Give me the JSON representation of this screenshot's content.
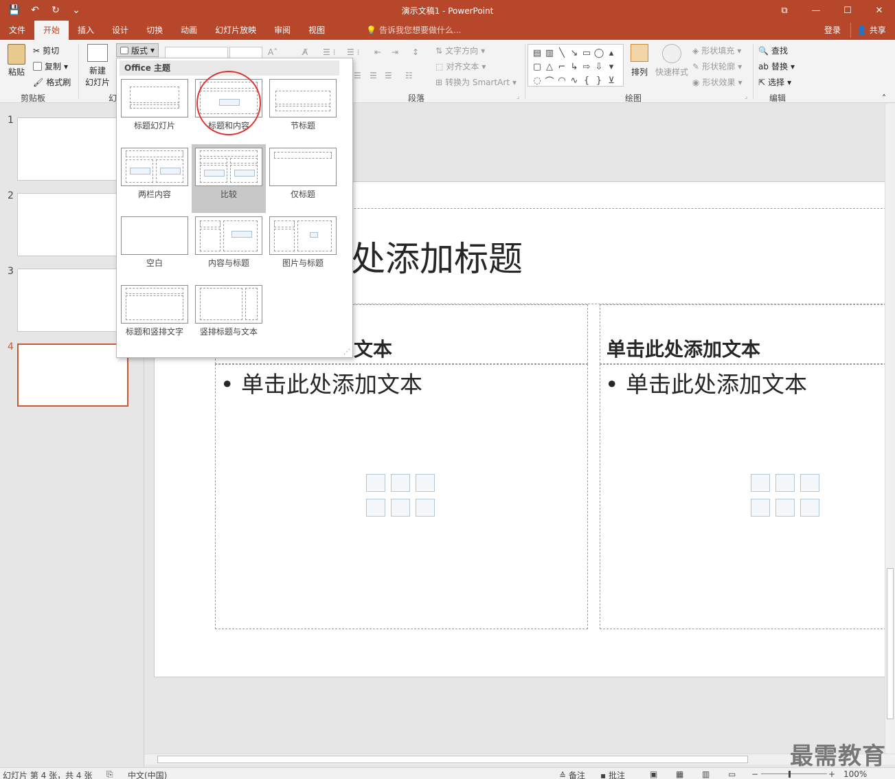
{
  "window": {
    "title": "演示文稿1 - PowerPoint",
    "controls": {
      "restore": "⧉",
      "minimize": "—",
      "maximize": "☐",
      "close": "✕"
    }
  },
  "qat": {
    "save": "💾",
    "undo": "↶",
    "redo": "↻",
    "customize": "⌄"
  },
  "tabs": [
    "文件",
    "开始",
    "插入",
    "设计",
    "切换",
    "动画",
    "幻灯片放映",
    "审阅",
    "视图"
  ],
  "active_tab": "开始",
  "tellme": {
    "placeholder": "告诉我您想要做什么..."
  },
  "account": {
    "signin": "登录",
    "share": "共享"
  },
  "ribbon": {
    "clipboard": {
      "label": "剪贴板",
      "paste": "粘贴",
      "cut": "剪切",
      "copy": "复制",
      "format_painter": "格式刷"
    },
    "slides": {
      "label": "幻",
      "new_slide_line1": "新建",
      "new_slide_line2": "幻灯片",
      "layout": "版式"
    },
    "paragraph": {
      "label": "段落",
      "text_direction": "文字方向",
      "align_text": "对齐文本",
      "convert_smartart": "转换为 SmartArt"
    },
    "drawing": {
      "label": "绘图",
      "arrange": "排列",
      "quick_styles": "快速样式",
      "shape_fill": "形状填充",
      "shape_outline": "形状轮廓",
      "shape_effects": "形状效果"
    },
    "editing": {
      "label": "编辑",
      "find": "查找",
      "replace": "替换",
      "select": "选择"
    }
  },
  "layout_dropdown": {
    "header": "Office 主题",
    "items": [
      "标题幻灯片",
      "标题和内容",
      "节标题",
      "两栏内容",
      "比较",
      "仅标题",
      "空白",
      "内容与标题",
      "图片与标题",
      "标题和竖排文字",
      "竖排标题与文本"
    ],
    "selected": "比较"
  },
  "thumbnails": [
    "1",
    "2",
    "3",
    "4"
  ],
  "active_thumbnail": "4",
  "slide": {
    "title_placeholder": "处添加标题",
    "left_header": "文本",
    "right_header": "单击此处添加文本",
    "left_body": "• 单击此处添加文本",
    "right_body": "• 单击此处添加文本"
  },
  "status": {
    "slide_info": "幻灯片 第 4 张，共 4 张",
    "language": "中文(中国)",
    "notes": "备注",
    "comments": "批注",
    "zoom": "100%"
  },
  "watermark": "最需教育",
  "colors": {
    "accent": "#b7472a",
    "selection": "#c55a3a"
  }
}
